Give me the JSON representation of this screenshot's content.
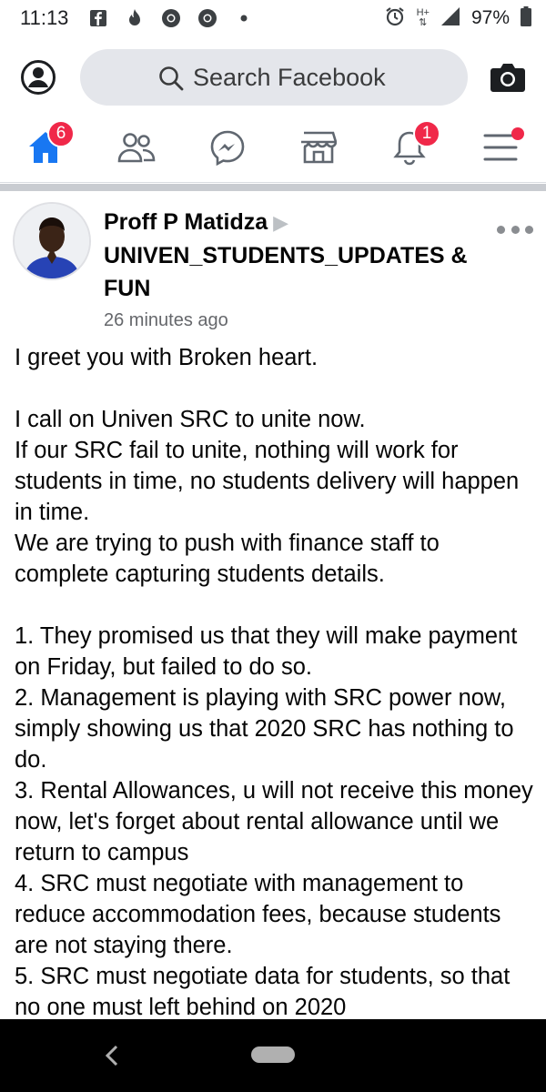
{
  "status_bar": {
    "time": "11:13",
    "network_label": "H+",
    "battery": "97%"
  },
  "top_bar": {
    "search_placeholder": "Search Facebook"
  },
  "nav": {
    "home_badge": "6",
    "notifications_badge": "1",
    "accent_color": "#1877f2",
    "badge_color": "#f02849"
  },
  "post": {
    "author": "Proff P Matidza",
    "group": "UNIVEN_STUDENTS_UPDATES & FUN",
    "time": "26 minutes ago",
    "paragraphs": [
      "I greet you with Broken heart.",
      "",
      "I call on Univen SRC to unite now.",
      "If our SRC fail to unite, nothing will work for students in time, no students delivery will happen in time.",
      "We are trying to push with finance staff to complete capturing students details.",
      "",
      "1. They promised us that they will make payment on Friday, but failed to do so.",
      "2. Management is playing with SRC power now, simply showing us that 2020 SRC has nothing to do.",
      "3. Rental Allowances, u will not receive this money now, let's forget about rental allowance until we return to campus",
      "4. SRC must negotiate with management to reduce accommodation fees, because students are not staying there.",
      "5. SRC must negotiate data for students, so that no one must left behind on 2020"
    ]
  }
}
